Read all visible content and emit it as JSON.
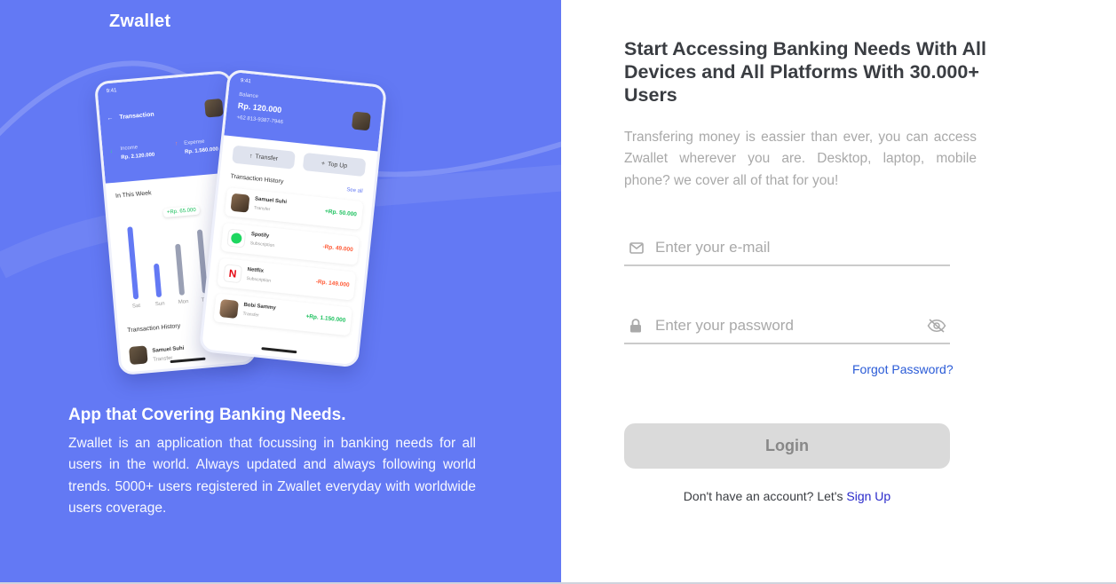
{
  "brand": {
    "name": "Zwallet"
  },
  "colors": {
    "primary": "#6379F4",
    "text_dark": "#3A3D42",
    "text_muted": "#A9A9A9",
    "button_disabled": "#DADADA",
    "income_green": "#1EC15F",
    "expense_red": "#FF5B37"
  },
  "left": {
    "title": "App that Covering Banking Needs.",
    "description": "Zwallet is an application that focussing in banking needs for all users in the world. Always updated and always following world trends. 5000+ users registered in Zwallet everyday with worldwide users coverage."
  },
  "phone_back": {
    "time": "9:41",
    "header_title": "Transaction",
    "income_label": "Income",
    "income_value": "Rp. 2.120.000",
    "expense_label": "Expense",
    "expense_value": "Rp. 1.560.000",
    "week_title": "In This Week",
    "bubble": "+Rp. 65.000",
    "day_labels": [
      "Sat",
      "Sun",
      "Mon",
      "Tue"
    ],
    "history_title": "Transaction History",
    "history_name": "Samuel Suhi",
    "history_sub": "Transfer"
  },
  "phone_front": {
    "time": "9:41",
    "balance_label": "Balance",
    "balance_value": "Rp. 120.000",
    "phone_number": "+62 813-9387-7946",
    "transfer_label": "Transfer",
    "topup_label": "Top Up",
    "history_title": "Transaction History",
    "see_all": "See all",
    "transactions": [
      {
        "name": "Samuel Suhi",
        "type": "Transfer",
        "amount": "+Rp. 50.000",
        "icon": "avatar-icon"
      },
      {
        "name": "Spotify",
        "type": "Subscription",
        "amount": "-Rp. 49.000",
        "icon": "spotify-icon"
      },
      {
        "name": "Netflix",
        "type": "Subscription",
        "amount": "-Rp. 149.000",
        "icon": "netflix-icon"
      },
      {
        "name": "Bobi Sammy",
        "type": "Transfer",
        "amount": "+Rp. 1.150.000",
        "icon": "avatar-icon"
      }
    ]
  },
  "right": {
    "title": "Start Accessing Banking Needs With All Devices and All Platforms With 30.000+ Users",
    "description": "Transfering money is eassier than ever, you can access Zwallet wherever you are. Desktop, laptop, mobile phone? we cover all of that for you!"
  },
  "form": {
    "email_placeholder": "Enter your e-mail",
    "password_placeholder": "Enter your password",
    "forgot_label": "Forgot Password?",
    "login_label": "Login",
    "signup_prompt": "Don't have an account? Let's ",
    "signup_link": "Sign Up"
  }
}
